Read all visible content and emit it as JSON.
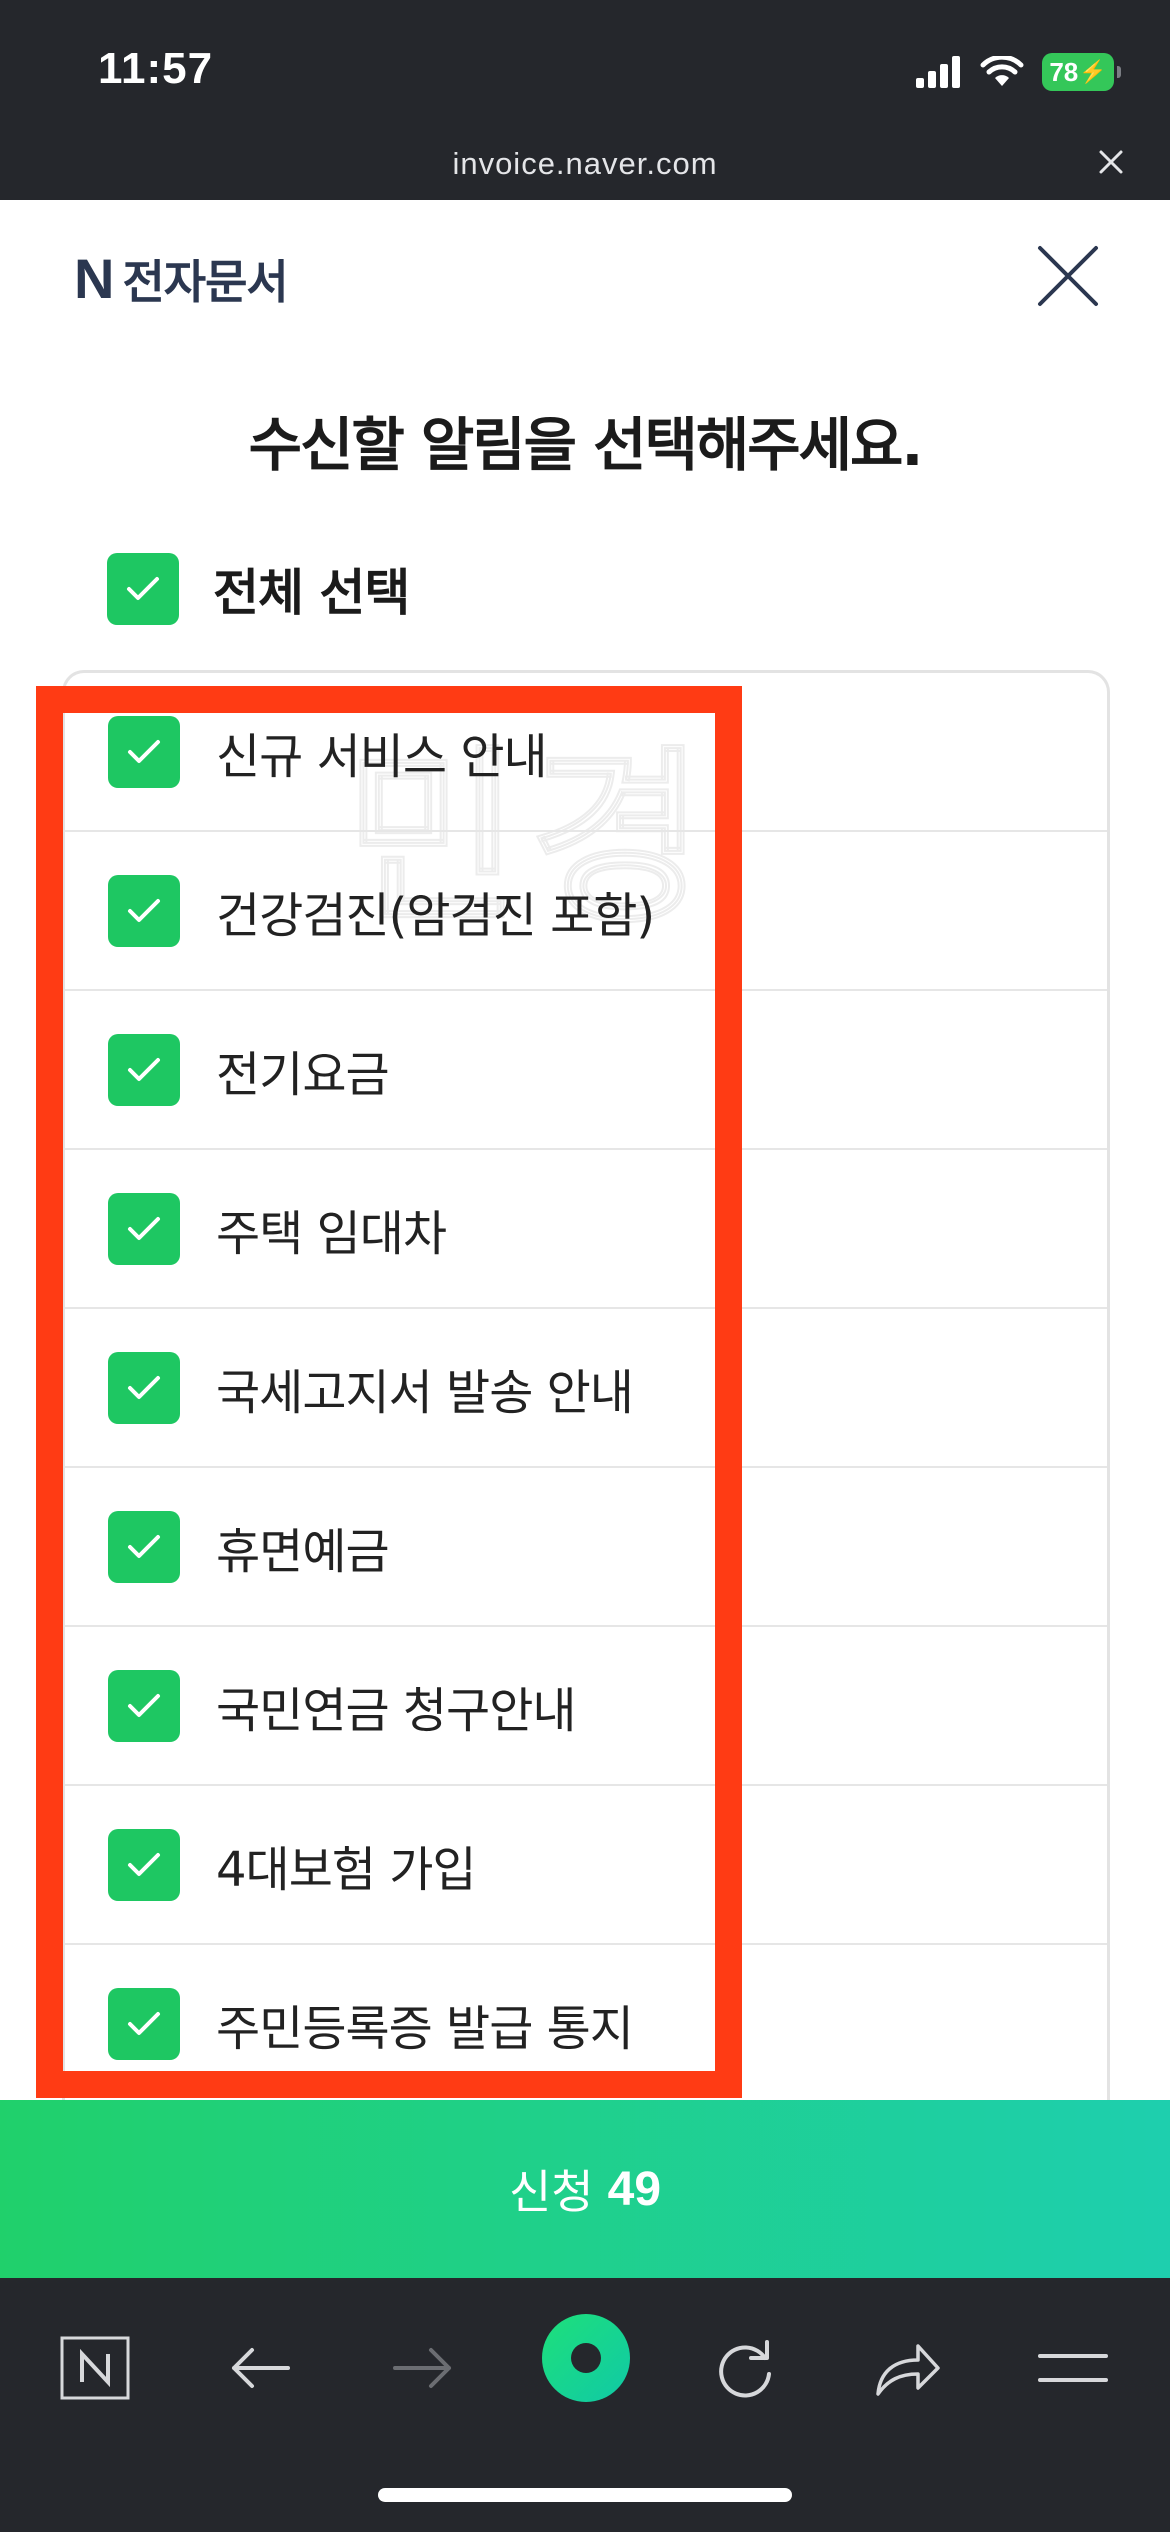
{
  "status_bar": {
    "time": "11:57",
    "battery": "78"
  },
  "browser": {
    "url": "invoice.naver.com"
  },
  "header": {
    "brand_mark": "N",
    "brand_text": "전자문서"
  },
  "page": {
    "title": "수신할 알림을 선택해주세요."
  },
  "select_all": {
    "label": "전체 선택",
    "checked": true
  },
  "watermark": "민경",
  "items": [
    {
      "label": "신규 서비스 안내",
      "checked": true
    },
    {
      "label": "건강검진(암검진 포함)",
      "checked": true
    },
    {
      "label": "전기요금",
      "checked": true
    },
    {
      "label": "주택 임대차",
      "checked": true
    },
    {
      "label": "국세고지서 발송 안내",
      "checked": true
    },
    {
      "label": "휴면예금",
      "checked": true
    },
    {
      "label": "국민연금 청구안내",
      "checked": true
    },
    {
      "label": "4대보험 가입",
      "checked": true
    },
    {
      "label": "주민등록증 발급 통지",
      "checked": true
    }
  ],
  "submit": {
    "label": "신청",
    "count": "49"
  },
  "colors": {
    "check": "#1ec762",
    "highlight": "#ff3b14",
    "submit_start": "#20d06b",
    "submit_end": "#1ecfae",
    "chrome": "#25272c"
  },
  "toolbar_icons": [
    "naver-home-icon",
    "back-arrow-icon",
    "forward-arrow-icon",
    "naver-green-dot-icon",
    "reload-icon",
    "share-icon",
    "menu-icon"
  ]
}
